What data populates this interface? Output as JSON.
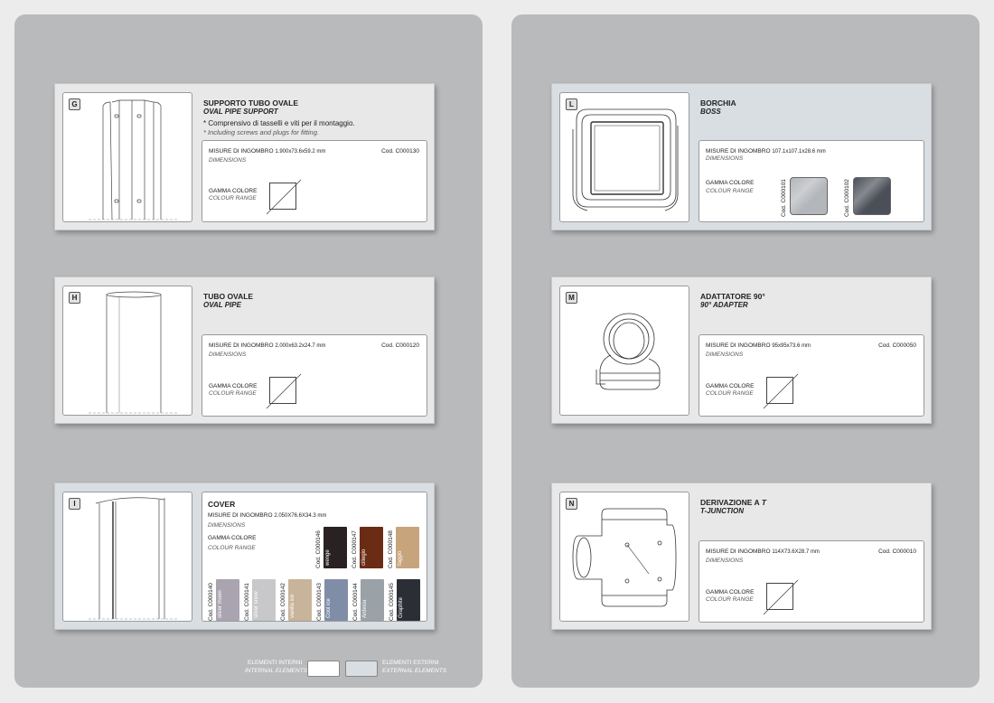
{
  "cards": {
    "G": {
      "letter": "G",
      "title": "SUPPORTO TUBO OVALE",
      "subtitle": "OVAL PIPE SUPPORT",
      "note_it": "* Comprensivo di tasselli e viti per il montaggio.",
      "note_en": "* Including screws and plugs for fitting.",
      "dim_label": "MISURE DI INGOMBRO",
      "dim_value": "1.900x73.6x59.2 mm",
      "dim_label_en": "DIMENSIONS",
      "code": "Cod. C000130",
      "colour_label": "GAMMA COLORE",
      "colour_label_en": "COLOUR RANGE"
    },
    "H": {
      "letter": "H",
      "title": "TUBO OVALE",
      "subtitle": "OVAL PIPE",
      "dim_label": "MISURE DI INGOMBRO",
      "dim_value": "2.000x63.2x24.7 mm",
      "dim_label_en": "DIMENSIONS",
      "code": "Cod. C000120",
      "colour_label": "GAMMA COLORE",
      "colour_label_en": "COLOUR RANGE"
    },
    "I": {
      "letter": "I",
      "title": "COVER",
      "dim_label": "MISURE DI INGOMBRO",
      "dim_value": "2.050X76.6X34.3 mm",
      "dim_label_en": "DIMENSIONS",
      "colour_label": "GAMMA COLORE",
      "colour_label_en": "COLOUR RANGE",
      "swatches_top": [
        {
          "code": "Cod. C000146",
          "name": "wenge",
          "color": "#2a2222"
        },
        {
          "code": "Cod. C000147",
          "name": "ciliegio",
          "color": "#6a2c14"
        },
        {
          "code": "Cod. C000148",
          "name": "faggio",
          "color": "#c8a47c"
        }
      ],
      "swatches_bottom": [
        {
          "code": "Cod. C000140",
          "name": "silver moon",
          "color": "#a9a4b0"
        },
        {
          "code": "Cod. C000141",
          "name": "silver snow",
          "color": "#c8c7c9"
        },
        {
          "code": "Cod. C000142",
          "name": "vanilla ice",
          "color": "#c8b49a"
        },
        {
          "code": "Cod. C000143",
          "name": "Cool ice",
          "color": "#7f8ea6"
        },
        {
          "code": "Cod. C000144",
          "name": "Ardesia",
          "color": "#9aa1a7"
        },
        {
          "code": "Cod. C000145",
          "name": "Graphite",
          "color": "#2b2e35"
        }
      ]
    },
    "L": {
      "letter": "L",
      "title": "BORCHIA",
      "subtitle": "BOSS",
      "dim_label": "MISURE DI INGOMBRO",
      "dim_value": "107.1x107.1x28.6 mm",
      "dim_label_en": "DIMENSIONS",
      "colour_label": "GAMMA COLORE",
      "colour_label_en": "COLOUR RANGE",
      "swatches": [
        {
          "code": "Cod. C000101",
          "color": "#b3b6ba"
        },
        {
          "code": "Cod. C000102",
          "color": "#4a4f58"
        }
      ]
    },
    "M": {
      "letter": "M",
      "title": "ADATTATORE 90°",
      "subtitle": "90° ADAPTER",
      "dim_label": "MISURE DI INGOMBRO",
      "dim_value": "95x95x73.6 mm",
      "dim_label_en": "DIMENSIONS",
      "code": "Cod. C000050",
      "colour_label": "GAMMA COLORE",
      "colour_label_en": "COLOUR RANGE"
    },
    "N": {
      "letter": "N",
      "title_prefix": "DERIVAZIONE A ",
      "title_em": "T",
      "subtitle": "T-JUNCTION",
      "dim_label": "MISURE DI INGOMBRO",
      "dim_value": "114X73.6X28.7 mm",
      "dim_label_en": "DIMENSIONS",
      "code": "Cod. C000010",
      "colour_label": "GAMMA COLORE",
      "colour_label_en": "COLOUR RANGE"
    }
  },
  "legend": {
    "internal_it": "ELEMENTI INTERNI",
    "internal_en": "INTERNAL ELEMENTS",
    "internal_color": "#ffffff",
    "external_it": "ELEMENTI ESTERNI",
    "external_en": "EXTERNAL ELEMENTS",
    "external_color": "#d9dee3"
  }
}
